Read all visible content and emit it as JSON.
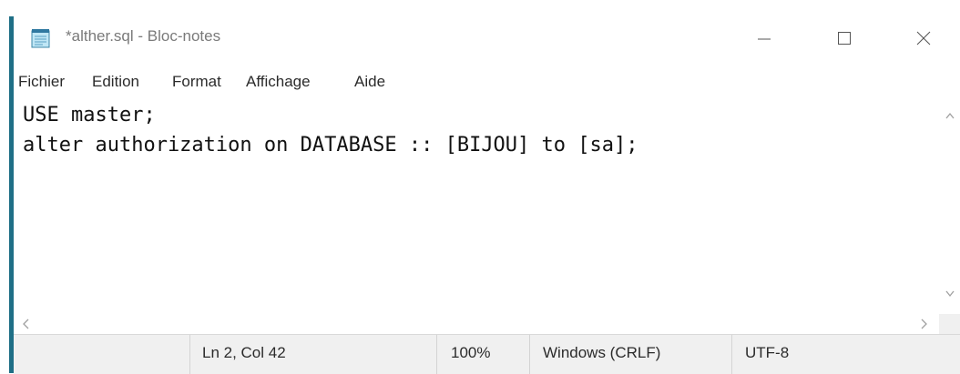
{
  "window": {
    "title": "*alther.sql - Bloc-notes",
    "icon": "notepad-icon",
    "controls": [
      "minimize-icon",
      "maximize-icon",
      "close-icon"
    ]
  },
  "menu": {
    "items": [
      "Fichier",
      "Edition",
      "Format",
      "Affichage",
      "Aide"
    ]
  },
  "editor": {
    "lines": [
      "USE master;",
      "alter authorization on DATABASE :: [BIJOU] to [sa];"
    ]
  },
  "status": {
    "position": "Ln 2, Col 42",
    "zoom": "100%",
    "line_ending": "Windows (CRLF)",
    "encoding": "UTF-8"
  },
  "colors": {
    "accent_edge": "#1f6f86",
    "statusbar_bg": "#f0f0f0"
  }
}
